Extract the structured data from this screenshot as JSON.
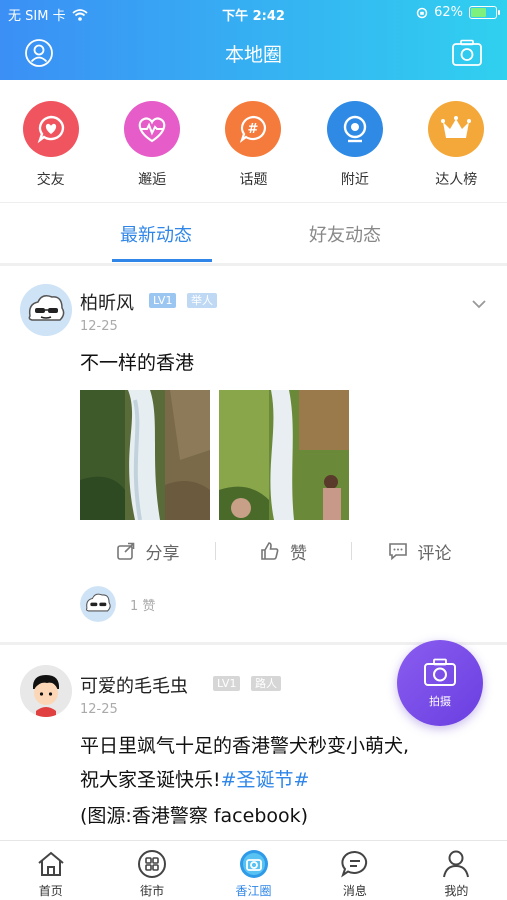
{
  "status_bar": {
    "carrier": "无 SIM 卡",
    "time": "下午 2:42",
    "battery": "62%",
    "battery_level": 0.62
  },
  "header": {
    "title": "本地圈",
    "left_icon": "user-icon",
    "right_icon": "camera-icon"
  },
  "categories": [
    {
      "label": "交友",
      "icon": "heart-chat-icon",
      "color": "#f0555f"
    },
    {
      "label": "邂逅",
      "icon": "heartbeat-icon",
      "color": "#e65cc8"
    },
    {
      "label": "话题",
      "icon": "hashtag-icon",
      "color": "#f57b3c"
    },
    {
      "label": "附近",
      "icon": "webcam-icon",
      "color": "#2f8ae6"
    },
    {
      "label": "达人榜",
      "icon": "crown-icon",
      "color": "#f4a83a"
    }
  ],
  "tabs": [
    {
      "label": "最新动态",
      "active": true
    },
    {
      "label": "好友动态",
      "active": false
    }
  ],
  "posts": [
    {
      "author": "柏昕风",
      "level": "LV1",
      "tag": "举人",
      "date": "12-25",
      "text": "不一样的香港",
      "actions": {
        "share": "分享",
        "like": "赞",
        "comment": "评论"
      },
      "likes": "1 赞"
    },
    {
      "author": "可爱的毛毛虫",
      "level": "LV1",
      "tag": "路人",
      "date": "12-25",
      "text_line1": "平日里飒气十足的香港警犬秒变小萌犬,",
      "text_line2_prefix": "祝大家圣诞快乐!",
      "hashtag": "#圣诞节#",
      "text_line3": "(图源:香港警察 facebook)"
    }
  ],
  "fab": {
    "label": "拍摄",
    "icon": "camera-icon"
  },
  "bottom_nav": [
    {
      "label": "首页",
      "icon": "home-icon",
      "active": false
    },
    {
      "label": "街市",
      "icon": "grid-icon",
      "active": false
    },
    {
      "label": "香江圈",
      "icon": "circle-camera-icon",
      "active": true
    },
    {
      "label": "消息",
      "icon": "chat-icon",
      "active": false
    },
    {
      "label": "我的",
      "icon": "person-icon",
      "active": false
    }
  ],
  "colors": {
    "accent": "#2f86e8",
    "header_start": "#3b8ff5",
    "header_end": "#30d0ef",
    "fab": "#7a4ce8"
  }
}
